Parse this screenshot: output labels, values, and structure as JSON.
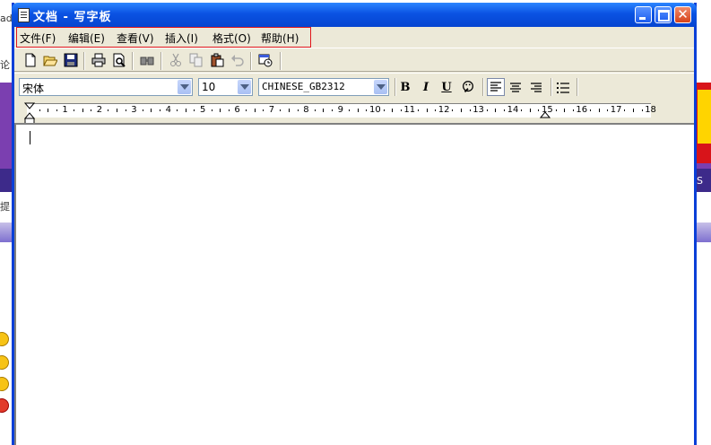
{
  "window": {
    "title": "文档 - 写字板"
  },
  "menu": [
    {
      "label": "文件(F)"
    },
    {
      "label": "编辑(E)"
    },
    {
      "label": "查看(V)"
    },
    {
      "label": "插入(I)"
    },
    {
      "label": "格式(O)"
    },
    {
      "label": "帮助(H)"
    }
  ],
  "toolbar": {
    "icons": [
      "new-icon",
      "open-icon",
      "save-icon",
      "print-icon",
      "print-preview-icon",
      "find-icon",
      "cut-icon",
      "copy-icon",
      "paste-icon",
      "undo-icon",
      "date-time-icon"
    ]
  },
  "format": {
    "font_name": "宋体",
    "font_size": "10",
    "script": "CHINESE_GB2312",
    "bold": "B",
    "italic": "I",
    "underline": "U"
  },
  "ruler": {
    "numbers": [
      "1",
      "2",
      "3",
      "4",
      "5",
      "6",
      "7",
      "8",
      "9",
      "10",
      "11",
      "12",
      "13",
      "14",
      "15",
      "16",
      "17",
      "18"
    ]
  },
  "background": {
    "left_texts": [
      "ado",
      "论",
      "提"
    ],
    "right_text": "S"
  },
  "colors": {
    "titlebar": "#0a52e3",
    "menu_highlight_border": "#e0161b",
    "window_face": "#ece9d8"
  }
}
